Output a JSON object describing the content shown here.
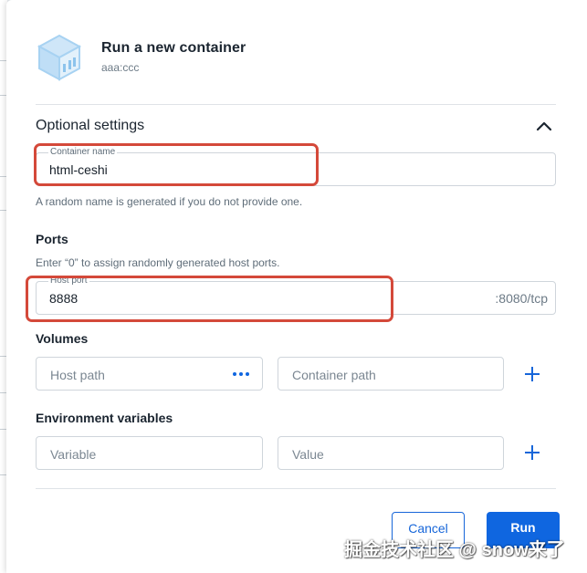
{
  "dialog": {
    "title": "Run a new container",
    "image_name": "aaa:ccc"
  },
  "optional_settings": {
    "title": "Optional settings",
    "container_name": {
      "label": "Container name",
      "value": "html-ceshi",
      "helper": "A random name is generated if you do not provide one."
    },
    "ports": {
      "title": "Ports",
      "helper": "Enter “0” to assign randomly generated host ports.",
      "host_port_label": "Host port",
      "host_port_value": "8888",
      "container_port": ":8080/tcp"
    },
    "volumes": {
      "title": "Volumes",
      "host_path_placeholder": "Host path",
      "container_path_placeholder": "Container path"
    },
    "env": {
      "title": "Environment variables",
      "variable_placeholder": "Variable",
      "value_placeholder": "Value"
    }
  },
  "actions": {
    "cancel_label": "Cancel",
    "run_label": "Run"
  },
  "watermark": "掘金技术社区 @ snow来了",
  "colors": {
    "primary": "#0f66e0",
    "annotation": "#d4493a",
    "border": "#cfd5db"
  },
  "icons": [
    "container-cube-icon",
    "chevron-up-icon",
    "more-horizontal-icon",
    "add-icon"
  ]
}
